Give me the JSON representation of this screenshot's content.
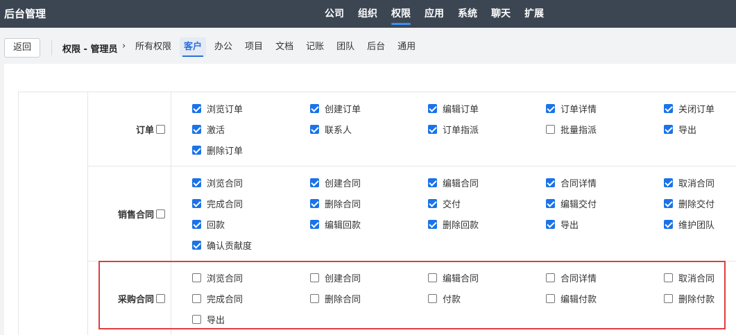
{
  "header": {
    "brand": "后台管理",
    "nav": [
      {
        "label": "公司",
        "active": false
      },
      {
        "label": "组织",
        "active": false
      },
      {
        "label": "权限",
        "active": true
      },
      {
        "label": "应用",
        "active": false
      },
      {
        "label": "系统",
        "active": false
      },
      {
        "label": "聊天",
        "active": false
      },
      {
        "label": "扩展",
        "active": false
      }
    ]
  },
  "subbar": {
    "back_label": "返回",
    "breadcrumb": "权限 - 管理员",
    "tabs": [
      {
        "label": "所有权限",
        "active": false
      },
      {
        "label": "客户",
        "active": true
      },
      {
        "label": "办公",
        "active": false
      },
      {
        "label": "项目",
        "active": false
      },
      {
        "label": "文档",
        "active": false
      },
      {
        "label": "记账",
        "active": false
      },
      {
        "label": "团队",
        "active": false
      },
      {
        "label": "后台",
        "active": false
      },
      {
        "label": "通用",
        "active": false
      }
    ]
  },
  "groups": [
    {
      "label": "订单",
      "checked": false,
      "items": [
        {
          "label": "浏览订单",
          "checked": true
        },
        {
          "label": "创建订单",
          "checked": true
        },
        {
          "label": "编辑订单",
          "checked": true
        },
        {
          "label": "订单详情",
          "checked": true
        },
        {
          "label": "关闭订单",
          "checked": true
        },
        {
          "label": "激活",
          "checked": true
        },
        {
          "label": "联系人",
          "checked": true
        },
        {
          "label": "订单指派",
          "checked": true
        },
        {
          "label": "批量指派",
          "checked": false
        },
        {
          "label": "导出",
          "checked": true
        },
        {
          "label": "删除订单",
          "checked": true
        }
      ]
    },
    {
      "label": "销售合同",
      "checked": false,
      "items": [
        {
          "label": "浏览合同",
          "checked": true
        },
        {
          "label": "创建合同",
          "checked": true
        },
        {
          "label": "编辑合同",
          "checked": true
        },
        {
          "label": "合同详情",
          "checked": true
        },
        {
          "label": "取消合同",
          "checked": true
        },
        {
          "label": "完成合同",
          "checked": true
        },
        {
          "label": "删除合同",
          "checked": true
        },
        {
          "label": "交付",
          "checked": true
        },
        {
          "label": "编辑交付",
          "checked": true
        },
        {
          "label": "删除交付",
          "checked": true
        },
        {
          "label": "回款",
          "checked": true
        },
        {
          "label": "编辑回款",
          "checked": true
        },
        {
          "label": "删除回款",
          "checked": true
        },
        {
          "label": "导出",
          "checked": true
        },
        {
          "label": "维护团队",
          "checked": true
        },
        {
          "label": "确认贡献度",
          "checked": true
        }
      ]
    },
    {
      "label": "采购合同",
      "checked": false,
      "items": [
        {
          "label": "浏览合同",
          "checked": false
        },
        {
          "label": "创建合同",
          "checked": false
        },
        {
          "label": "编辑合同",
          "checked": false
        },
        {
          "label": "合同详情",
          "checked": false
        },
        {
          "label": "取消合同",
          "checked": false
        },
        {
          "label": "完成合同",
          "checked": false
        },
        {
          "label": "删除合同",
          "checked": false
        },
        {
          "label": "付款",
          "checked": false
        },
        {
          "label": "编辑付款",
          "checked": false
        },
        {
          "label": "删除付款",
          "checked": false
        },
        {
          "label": "导出",
          "checked": false
        }
      ]
    }
  ],
  "colors": {
    "topbar": "#3c4653",
    "accent": "#1a73e8",
    "highlight": "#e03c3c"
  }
}
